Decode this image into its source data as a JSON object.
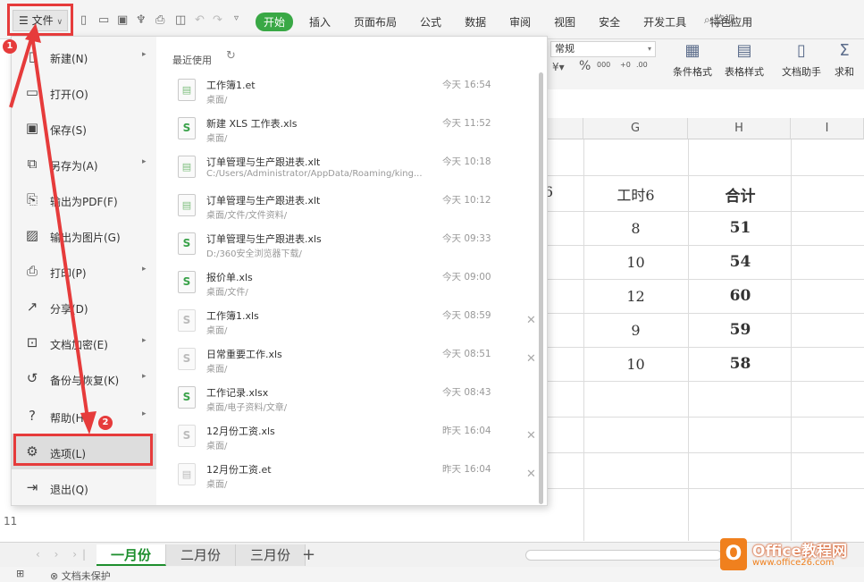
{
  "toolbar": {
    "file_label": "文件",
    "tabs": [
      "开始",
      "插入",
      "页面布局",
      "公式",
      "数据",
      "审阅",
      "视图",
      "安全",
      "开发工具",
      "特色应用"
    ],
    "search_label": "监视"
  },
  "ribbon": {
    "number_format": "常规",
    "conditional_format": "条件格式",
    "table_style": "表格样式",
    "doc_assistant": "文档助手",
    "sum": "求和"
  },
  "file_menu": {
    "items": [
      {
        "label": "新建(N)",
        "icon": "new-doc-icon",
        "has_submenu": true
      },
      {
        "label": "打开(O)",
        "icon": "folder-icon",
        "has_submenu": false
      },
      {
        "label": "保存(S)",
        "icon": "save-icon",
        "has_submenu": false
      },
      {
        "label": "另存为(A)",
        "icon": "save-as-icon",
        "has_submenu": true
      },
      {
        "label": "输出为PDF(F)",
        "icon": "pdf-icon",
        "has_submenu": false
      },
      {
        "label": "输出为图片(G)",
        "icon": "image-icon",
        "has_submenu": false
      },
      {
        "label": "打印(P)",
        "icon": "print-icon",
        "has_submenu": true
      },
      {
        "label": "分享(D)",
        "icon": "share-icon",
        "has_submenu": false
      },
      {
        "label": "文档加密(E)",
        "icon": "encrypt-icon",
        "has_submenu": true
      },
      {
        "label": "备份与恢复(K)",
        "icon": "backup-icon",
        "has_submenu": true
      },
      {
        "label": "帮助(H)",
        "icon": "help-icon",
        "has_submenu": true
      },
      {
        "label": "选项(L)",
        "icon": "gear-icon",
        "has_submenu": false
      },
      {
        "label": "退出(Q)",
        "icon": "exit-icon",
        "has_submenu": false
      }
    ]
  },
  "recent": {
    "header": "最近使用",
    "files": [
      {
        "name": "工作簿1.et",
        "path": "桌面/",
        "time": "今天 16:54",
        "type": "grid"
      },
      {
        "name": "新建 XLS 工作表.xls",
        "path": "桌面/",
        "time": "今天 11:52",
        "type": "sheet"
      },
      {
        "name": "订单管理与生产跟进表.xlt",
        "path": "C:/Users/Administrator/AppData/Roaming/king...",
        "time": "今天 10:18",
        "type": "grid"
      },
      {
        "name": "订单管理与生产跟进表.xlt",
        "path": "桌面/文件/文件资料/",
        "time": "今天 10:12",
        "type": "grid"
      },
      {
        "name": "订单管理与生产跟进表.xls",
        "path": "D:/360安全浏览器下载/",
        "time": "今天 09:33",
        "type": "sheet"
      },
      {
        "name": "报价单.xls",
        "path": "桌面/文件/",
        "time": "今天 09:00",
        "type": "sheet"
      },
      {
        "name": "工作簿1.xls",
        "path": "桌面/",
        "time": "今天 08:59",
        "type": "faded"
      },
      {
        "name": "日常重要工作.xls",
        "path": "桌面/",
        "time": "今天 08:51",
        "type": "faded"
      },
      {
        "name": "工作记录.xlsx",
        "path": "桌面/电子资料/文章/",
        "time": "今天 08:43",
        "type": "sheet"
      },
      {
        "name": "12月份工资.xls",
        "path": "桌面/",
        "time": "昨天 16:04",
        "type": "faded"
      },
      {
        "name": "12月份工资.et",
        "path": "桌面/",
        "time": "昨天 16:04",
        "type": "grid"
      }
    ]
  },
  "sheet": {
    "col_headers": [
      "G",
      "H",
      "I"
    ],
    "header_row": [
      "工时6",
      "合计"
    ],
    "partial_header": "6",
    "rows": [
      [
        "8",
        "51"
      ],
      [
        "10",
        "54"
      ],
      [
        "12",
        "60"
      ],
      [
        "9",
        "59"
      ],
      [
        "10",
        "58"
      ]
    ],
    "row11_label": "11"
  },
  "sheet_tabs": [
    "一月份",
    "二月份",
    "三月份"
  ],
  "status": {
    "protect": "文档未保护"
  },
  "annotations": {
    "badge1": "1",
    "badge2": "2"
  },
  "watermark": {
    "title": "Office教程网",
    "url": "www.office26.com"
  },
  "colors": {
    "accent_green": "#39a845",
    "annotation_red": "#e63b3b",
    "watermark_orange": "#f0801e"
  }
}
